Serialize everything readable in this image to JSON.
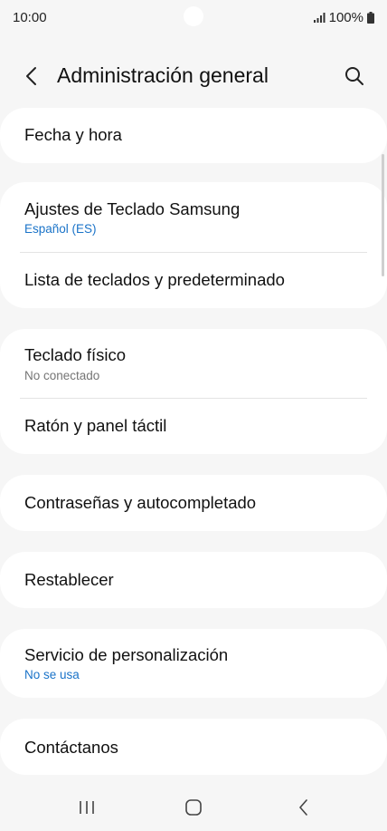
{
  "status_bar": {
    "time": "10:00",
    "battery": "100%"
  },
  "header": {
    "title": "Administración general"
  },
  "items": [
    {
      "title": "Fecha y hora"
    },
    {
      "title": "Ajustes de Teclado Samsung",
      "subtitle": "Español (ES)"
    },
    {
      "title": "Lista de teclados y predeterminado"
    },
    {
      "title": "Teclado físico",
      "subtitle": "No conectado"
    },
    {
      "title": "Ratón y panel táctil"
    },
    {
      "title": "Contraseñas y autocompletado"
    },
    {
      "title": "Restablecer"
    },
    {
      "title": "Servicio de personalización",
      "subtitle": "No se usa"
    },
    {
      "title": "Contáctanos"
    }
  ],
  "colors": {
    "accent": "#1a73c8",
    "secondary_text": "#757575",
    "background": "#f6f6f6",
    "card": "#ffffff"
  }
}
